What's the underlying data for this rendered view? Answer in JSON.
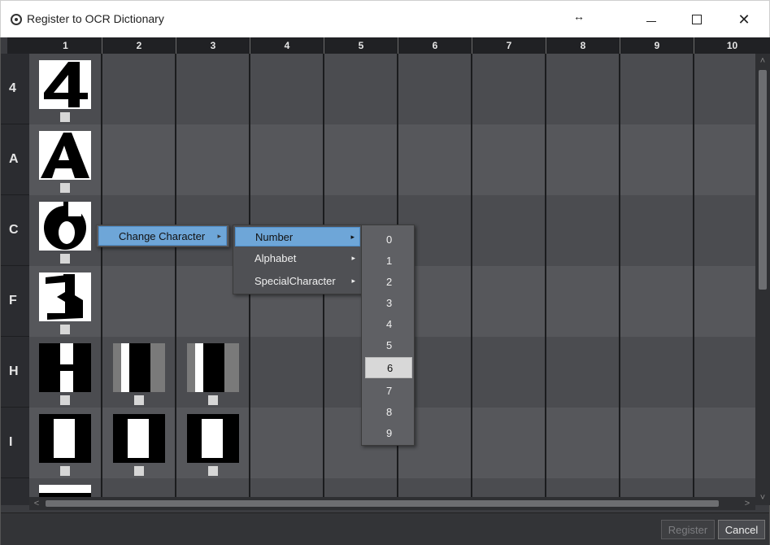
{
  "window": {
    "title": "Register to OCR Dictionary",
    "resize_glyph": "↔",
    "close_glyph": "✕"
  },
  "grid": {
    "columns": [
      "1",
      "2",
      "3",
      "4",
      "5",
      "6",
      "7",
      "8",
      "9",
      "10"
    ],
    "rows": [
      "4",
      "A",
      "C",
      "F",
      "H",
      "I"
    ],
    "cells": [
      {
        "row": "4",
        "col": "1",
        "image": "digit-4-glyph"
      },
      {
        "row": "A",
        "col": "1",
        "image": "letter-A-glyph"
      },
      {
        "row": "C",
        "col": "1",
        "image": "digit-6-glyph"
      },
      {
        "row": "F",
        "col": "1",
        "image": "digit-3-glyph"
      },
      {
        "row": "H",
        "col": "1",
        "image": "letter-H-glyph"
      },
      {
        "row": "H",
        "col": "2",
        "image": "letter-H-fragment-glyph"
      },
      {
        "row": "H",
        "col": "3",
        "image": "letter-H-fragment-glyph"
      },
      {
        "row": "I",
        "col": "1",
        "image": "letter-I-glyph"
      },
      {
        "row": "I",
        "col": "2",
        "image": "letter-I-glyph"
      },
      {
        "row": "I",
        "col": "3",
        "image": "letter-I-glyph"
      }
    ]
  },
  "context_menu": {
    "level1": {
      "label": "Change Character",
      "arrow": "▸"
    },
    "level2": [
      {
        "label": "Number",
        "arrow": "▸",
        "highlighted": true
      },
      {
        "label": "Alphabet",
        "arrow": "▸",
        "highlighted": false
      },
      {
        "label": "SpecialCharacter",
        "arrow": "▸",
        "highlighted": false
      }
    ],
    "level3": [
      "0",
      "1",
      "2",
      "3",
      "4",
      "5",
      "6",
      "7",
      "8",
      "9"
    ],
    "level3_selected": "6"
  },
  "scrollbars": {
    "up_glyph": "˄",
    "down_glyph": "˅",
    "left_glyph": "<",
    "right_glyph": ">"
  },
  "footer": {
    "register_label": "Register",
    "cancel_label": "Cancel"
  },
  "colors": {
    "background": "#3b3c40",
    "menu_highlight": "#6ea6d8",
    "selected_item": "#d8d8d8"
  }
}
